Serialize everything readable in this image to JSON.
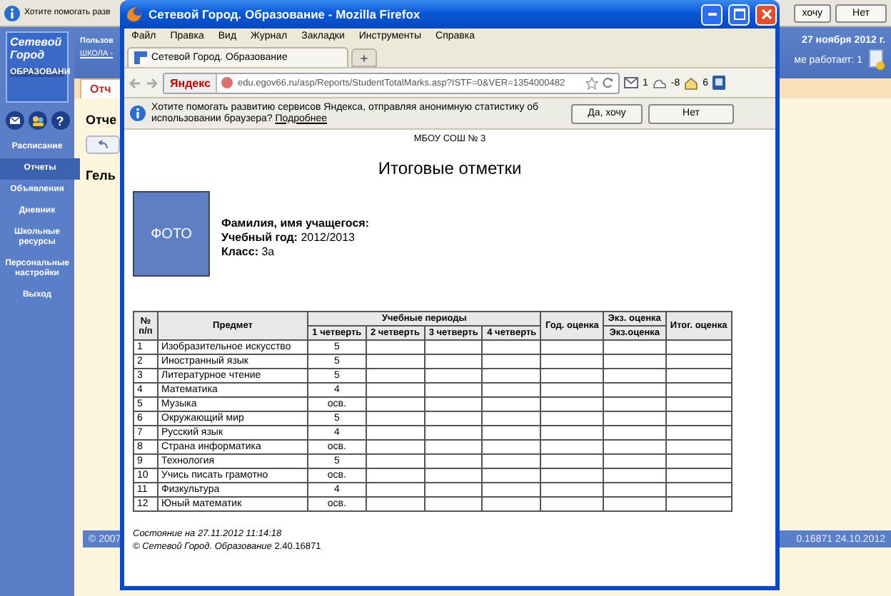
{
  "yandex_bar": {
    "text": "Хотите помогать разв",
    "buttons": [
      "хочу",
      "Нет"
    ]
  },
  "app": {
    "logo": {
      "line_1": "Сетевой",
      "line_2": "Город",
      "line_3": "ОБРАЗОВАНИ"
    },
    "help_icon": "?",
    "sidebar": {
      "items": [
        {
          "label": "Расписание",
          "selected": false
        },
        {
          "label": "Отчеты",
          "selected": true
        },
        {
          "label": "Объявления",
          "selected": false
        },
        {
          "label": "Дневник",
          "selected": false
        },
        {
          "label": "Школьные ресурсы",
          "selected": false
        },
        {
          "label": "Персональные настройки",
          "selected": false
        },
        {
          "label": "Выход",
          "selected": false
        }
      ]
    },
    "header": {
      "user": "Пользов",
      "school": "ШКОЛА -",
      "date": "27 ноября 2012 г.",
      "online": "ме работает: 1"
    },
    "tab": "Отч",
    "title": "Отче",
    "name": "Гель",
    "footer": {
      "left": "© 2007",
      "right": "0.16871   24.10.2012"
    }
  },
  "browser": {
    "title": "Сетевой Город. Образование - Mozilla Firefox",
    "menu": [
      "Файл",
      "Правка",
      "Вид",
      "Журнал",
      "Закладки",
      "Инструменты",
      "Справка"
    ],
    "tabs": [
      {
        "label": "Сетевой Город. Образование",
        "selected": true
      }
    ],
    "new_tab": "+",
    "search_engine": "Яндекс",
    "url": "edu.egov66.ru/asp/Reports/StudentTotalMarks.asp?ISTF=0&VER=1354000482",
    "toolbar_counts": {
      "mail": "1",
      "weather": "-8",
      "home": "6"
    },
    "notification": {
      "text": "Хотите помогать развитию сервисов Яндекса, отправляя анонимную статистику об использовании браузера?",
      "link": "Подробнее",
      "buttons": [
        "Да, хочу",
        "Нет"
      ]
    },
    "page": {
      "school": "МБОУ СОШ № 3",
      "heading": "Итоговые отметки",
      "photo": "ФОТО",
      "info": [
        "**Фамилия, имя учащегося:**",
        "**Учебный год:** 2012/2013",
        "**Класс:** 3а"
      ],
      "table": {
        "header": {
          "number": "№ п/п",
          "subject": "Предмет",
          "periods": "Учебные периоды",
          "period_columns": [
            "1 четверть",
            "2 четверть",
            "3 четверть",
            "4 четверть"
          ],
          "year": "Год. оценка",
          "exam": "Экз. оценка",
          "exam_sub": "Экз.оценка",
          "final": "Итог. оценка"
        },
        "rows": [
          {
            "number": "1",
            "subject": "Изобразительное искусство",
            "q1": "5"
          },
          {
            "number": "2",
            "subject": "Иностранный язык",
            "q1": "5"
          },
          {
            "number": "3",
            "subject": "Литературное чтение",
            "q1": "5"
          },
          {
            "number": "4",
            "subject": "Математика",
            "q1": "4"
          },
          {
            "number": "5",
            "subject": "Музыка",
            "q1": "осв."
          },
          {
            "number": "6",
            "subject": "Окружающий мир",
            "q1": "5"
          },
          {
            "number": "7",
            "subject": "Русский язык",
            "q1": "4"
          },
          {
            "number": "8",
            "subject": "Страна информатика",
            "q1": "осв."
          },
          {
            "number": "9",
            "subject": "Технология",
            "q1": "5"
          },
          {
            "number": "10",
            "subject": "Учись писать грамотно",
            "q1": "осв."
          },
          {
            "number": "11",
            "subject": "Физкультура",
            "q1": "4"
          },
          {
            "number": "12",
            "subject": "Юный математик",
            "q1": "осв."
          }
        ]
      },
      "status": "Состояние на 27.11.2012 11:14:18",
      "copyright": "*© Сетевой Город. Образование* 2.40.16871"
    }
  }
}
